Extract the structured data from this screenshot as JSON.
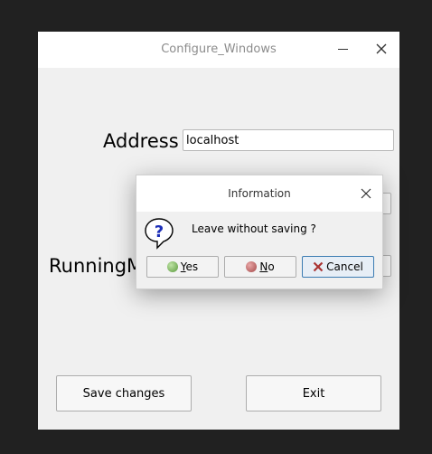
{
  "main_window": {
    "title": "Configure_Windows",
    "address_label": "Address",
    "address_value": "localhost",
    "running_label": "RunningM",
    "save_button": "Save changes",
    "exit_button": "Exit"
  },
  "dialog": {
    "title": "Information",
    "message": "Leave without saving ?",
    "yes_mnemonic": "Y",
    "yes_rest": "es",
    "no_mnemonic": "N",
    "no_rest": "o",
    "cancel_label": "Cancel"
  },
  "colors": {
    "background": "#212121",
    "window": "#f0f0f0",
    "titlebar": "#ffffff",
    "focus_border": "#3c7cb2"
  },
  "icons": [
    "minimize-icon",
    "close-icon",
    "question-icon",
    "yes-icon",
    "no-icon",
    "cancel-icon"
  ]
}
